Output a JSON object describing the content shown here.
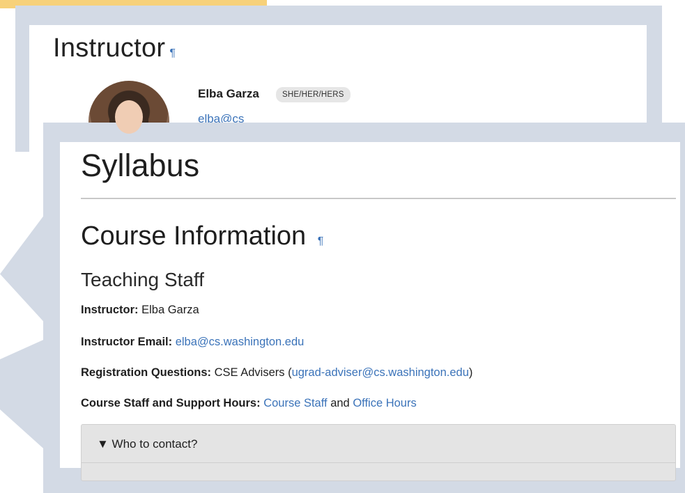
{
  "instructor_card": {
    "heading": "Instructor",
    "pilcrow": "¶",
    "name": "Elba Garza",
    "pronouns": "SHE/HER/HERS",
    "email": "elba@cs"
  },
  "syllabus": {
    "title": "Syllabus",
    "section_title": "Course Information",
    "section_pilcrow": "¶",
    "subsection_title": "Teaching Staff",
    "instructor_label": "Instructor:",
    "instructor_value": "Elba Garza",
    "email_label": "Instructor Email:",
    "email_link": "elba@cs.washington.edu",
    "registration_label": "Registration Questions:",
    "registration_text": "CSE Advisers (",
    "registration_link": "ugrad-adviser@cs.washington.edu",
    "registration_close": ")",
    "staff_label": "Course Staff and Support Hours:",
    "staff_link1": "Course Staff",
    "staff_and": "and",
    "staff_link2": "Office Hours",
    "details_summary": "▼ Who to contact?"
  },
  "colors": {
    "accent": "#f7d17a",
    "frame": "#d3dae5",
    "link": "#3b73b9"
  }
}
